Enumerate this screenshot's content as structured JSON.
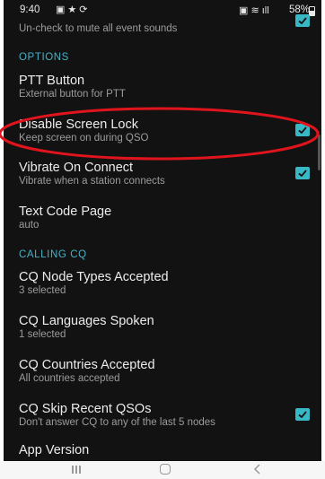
{
  "status_bar": {
    "time": "9:40",
    "battery": "58%",
    "left_icons": [
      "gallery-icon",
      "star-icon",
      "sync-icon"
    ],
    "right_icons": [
      "alarm-icon",
      "wifi-icon",
      "signal-icon",
      "battery-icon"
    ]
  },
  "partial_item": {
    "summary": "Un-check to mute all event sounds",
    "checked": true
  },
  "sections": {
    "options": "OPTIONS",
    "calling_cq": "CALLING CQ"
  },
  "items": [
    {
      "title": "PTT Button",
      "summary": "External button for PTT",
      "checkbox": false
    },
    {
      "title": "Disable Screen Lock",
      "summary": "Keep screen on during QSO",
      "checkbox": true,
      "checked": true
    },
    {
      "title": "Vibrate On Connect",
      "summary": "Vibrate when a station connects",
      "checkbox": true,
      "checked": true
    },
    {
      "title": "Text Code Page",
      "summary": "auto",
      "checkbox": false
    },
    {
      "title": "CQ Node Types Accepted",
      "summary": "3 selected",
      "checkbox": false
    },
    {
      "title": "CQ Languages Spoken",
      "summary": "1 selected",
      "checkbox": false
    },
    {
      "title": "CQ Countries Accepted",
      "summary": "All countries accepted",
      "checkbox": false
    },
    {
      "title": "CQ Skip Recent QSOs",
      "summary": "Don't answer CQ to any of the last 5 nodes",
      "checkbox": true,
      "checked": true
    },
    {
      "title": "App Version",
      "summary": "",
      "checkbox": false
    }
  ],
  "colors": {
    "background": "#121212",
    "accent": "#38b8c4",
    "section_header": "#4ab0c4",
    "highlight_annotation": "#e0141c"
  }
}
